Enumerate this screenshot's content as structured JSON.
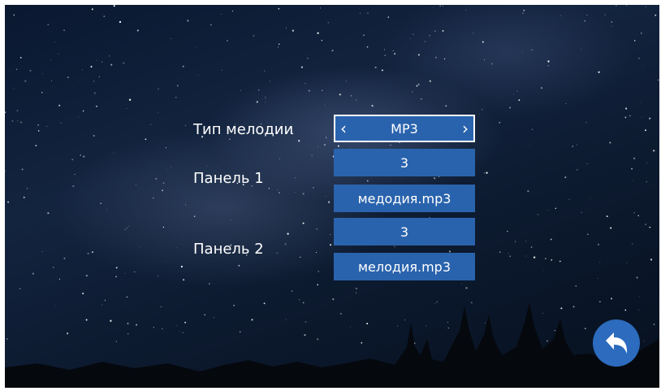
{
  "settings": {
    "melody_type_label": "Тип мелодии",
    "melody_type_value": "MP3",
    "panel1_label": "Панель 1",
    "panel1_volume": "3",
    "panel1_file": "медодия.mp3",
    "panel2_label": "Панель 2",
    "panel2_volume": "3",
    "panel2_file": "мелодия.mp3"
  },
  "icons": {
    "prev": "chevron-left-icon",
    "next": "chevron-right-icon",
    "back": "back-arrow-icon"
  },
  "colors": {
    "field_bg": "#2a63ad",
    "back_button_bg": "#2c6bbd",
    "text": "#ffffff"
  }
}
